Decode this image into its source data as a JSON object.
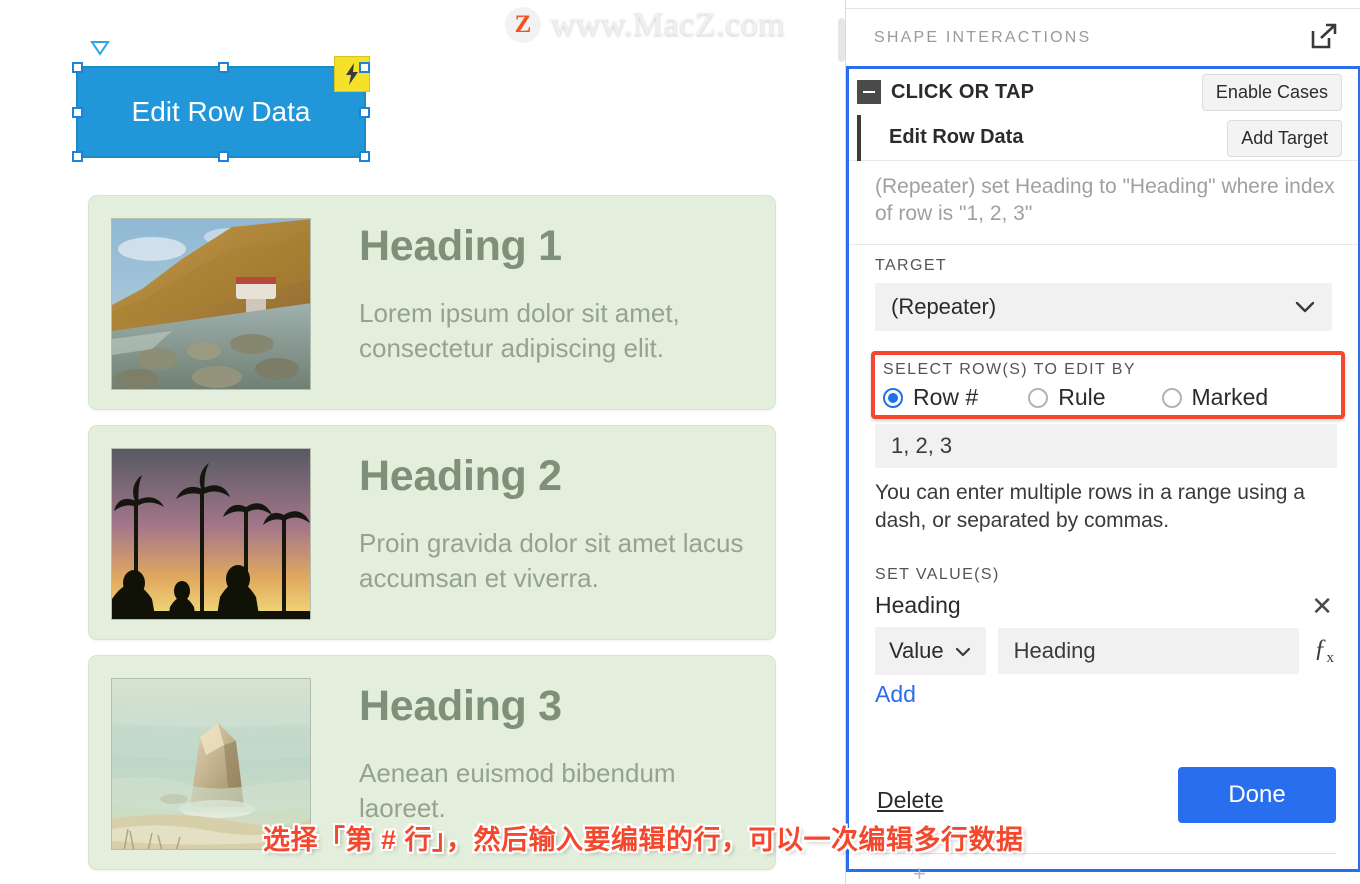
{
  "watermark": {
    "logo_letter": "Z",
    "text": "www.MacZ.com"
  },
  "canvas": {
    "widget": {
      "label": "Edit Row Data",
      "badge_icon": "lightning-bolt-icon",
      "rotate_icon": "rotate-handle-icon",
      "fill_color": "#2196d9",
      "handle_color": "#1f82d6"
    },
    "cards": [
      {
        "heading": "Heading 1",
        "text": "Lorem ipsum dolor sit amet, consectetur adipiscing elit.",
        "image_alt": "coastal-cliff-photo"
      },
      {
        "heading": "Heading 2",
        "text": "Proin gravida dolor sit amet lacus accumsan et viverra.",
        "image_alt": "palm-trees-sunset-photo"
      },
      {
        "heading": "Heading 3",
        "text": "Aenean euismod bibendum laoreet.",
        "image_alt": "beach-rock-photo"
      }
    ],
    "card_bg_color": "#e3efdc",
    "heading_color": "#7f9079"
  },
  "caption": "选择「第 # 行」，然后输入要编辑的行，可以一次编辑多行数据",
  "panel": {
    "header": {
      "title": "SHAPE INTERACTIONS",
      "popout_icon": "external-link-icon"
    },
    "event": {
      "title": "CLICK OR TAP",
      "collapse_icon": "collapse-minus-icon",
      "enable_cases_label": "Enable Cases"
    },
    "action": {
      "title": "Edit Row Data",
      "add_target_label": "Add Target",
      "summary": "(Repeater) set Heading to \"Heading\" where index of row is \"1, 2, 3\""
    },
    "target": {
      "label": "TARGET",
      "value": "(Repeater)",
      "chevron_icon": "chevron-down-icon"
    },
    "row_select": {
      "label": "SELECT ROW(S) TO EDIT BY",
      "options": [
        {
          "label": "Row #",
          "selected": true
        },
        {
          "label": "Rule",
          "selected": false
        },
        {
          "label": "Marked",
          "selected": false
        }
      ],
      "highlight_color": "#f4482e"
    },
    "rows_input": {
      "value": "1, 2, 3"
    },
    "rows_hint": "You can enter multiple rows in a range using a dash, or separated by commas.",
    "set_values": {
      "label": "SET VALUE(S)",
      "name": "Heading",
      "remove_icon": "close-x-icon",
      "type": "Value",
      "type_chevron_icon": "chevron-down-icon",
      "value": "Heading",
      "fx_icon": "fx-function-icon",
      "add_label": "Add"
    },
    "footer": {
      "delete_label": "Delete",
      "done_label": "Done",
      "done_color": "#2a6ef0"
    },
    "selection_border_color": "#2a6ef0"
  }
}
